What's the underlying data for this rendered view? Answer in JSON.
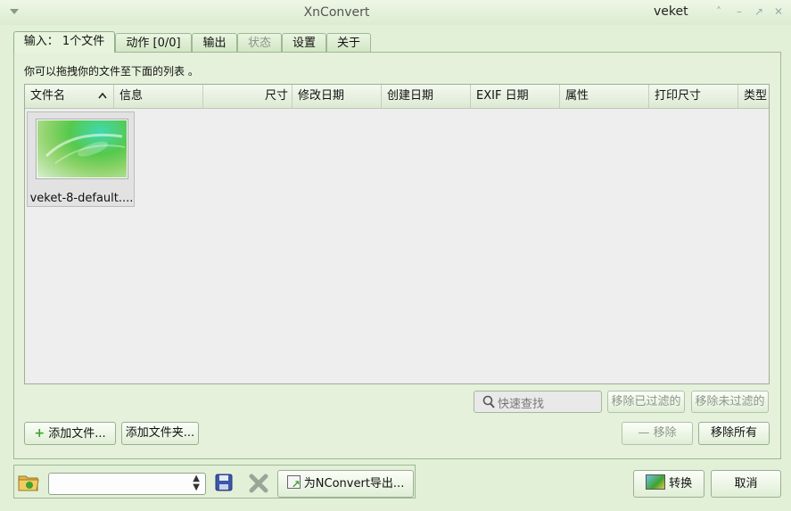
{
  "window": {
    "title": "XnConvert",
    "user": "veket"
  },
  "tabs": [
    {
      "label": "输入： 1个文件"
    },
    {
      "label": "动作 [0/0]"
    },
    {
      "label": "输出"
    },
    {
      "label": "状态"
    },
    {
      "label": "设置"
    },
    {
      "label": "关于"
    }
  ],
  "input": {
    "hint": "你可以拖拽你的文件至下面的列表 。",
    "columns": [
      "文件名",
      "信息",
      "尺寸",
      "修改日期",
      "创建日期",
      "EXIF 日期",
      "属性",
      "打印尺寸",
      "类型"
    ],
    "files": [
      {
        "name": "veket-8-default...."
      }
    ],
    "quick_search_placeholder": "快速查找",
    "remove_filtered": "移除已过滤的",
    "remove_unfiltered": "移除未过滤的",
    "add_files": "添加文件...",
    "add_folder": "添加文件夹...",
    "remove": "移除",
    "remove_all": "移除所有"
  },
  "bottom": {
    "profile_value": "",
    "export_label": "为NConvert导出...",
    "convert_label": "转换",
    "cancel_label": "取消"
  },
  "colors": {
    "background": "#e3f0d8",
    "accent_green": "#3ea32e"
  },
  "icons": [
    "menu-triangle-icon",
    "sort-ascending-icon",
    "search-icon",
    "plus-icon",
    "minus-icon",
    "folder-icon",
    "save-icon",
    "delete-icon",
    "export-icon",
    "convert-icon"
  ]
}
